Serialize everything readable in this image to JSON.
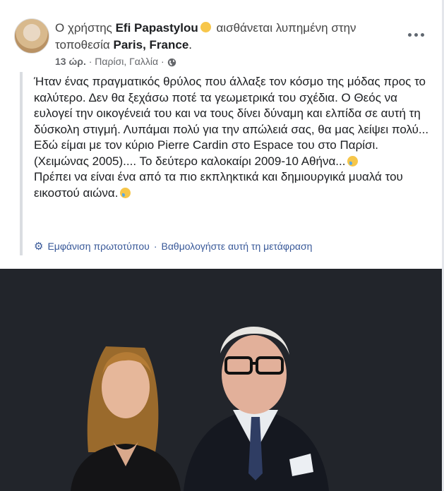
{
  "post": {
    "prefix": "Ο χρήστης",
    "author": "Efi Papastylou",
    "feeling": "αισθάνεται λυπημένη στην τοποθεσία",
    "location": "Paris, France",
    "location_suffix": ".",
    "time": "13 ώρ.",
    "place": "· Παρίσι, Γαλλία ·",
    "privacy_icon": "globe-icon",
    "more_icon": "more-options-icon"
  },
  "body": {
    "line1": "Ήταν ένας πραγματικός θρύλος που άλλαξε τον κόσμο της μόδας προς το καλύτερο. Δεν θα ξεχάσω ποτέ τα γεωμετρικά του σχέδια. Ο Θεός να ευλογεί την οικογένειά του και να τους δίνει δύναμη και ελπίδα σε αυτή τη δύσκολη στιγμή. Λυπάμαι πολύ για την απώλειά σας, θα μας λείψει πολύ... Εδώ είμαι με τον κύριο Pierre Cardin στο Espace του στο Παρίσι. (Χειμώνας 2005).... Το δεύτερο καλοκαίρι 2009-10 Αθήνα...",
    "line2": "Πρέπει να είναι ένα από τα πιο εκπληκτικά και δημιουργικά μυαλά του εικοστού αιώνα."
  },
  "translation": {
    "see_original": "Εμφάνιση πρωτοτύπου",
    "separator": "·",
    "rate": "Βαθμολογήστε αυτή τη μετάφραση"
  },
  "colors": {
    "link": "#385898",
    "text": "#1c1e21",
    "meta": "#65676b"
  }
}
